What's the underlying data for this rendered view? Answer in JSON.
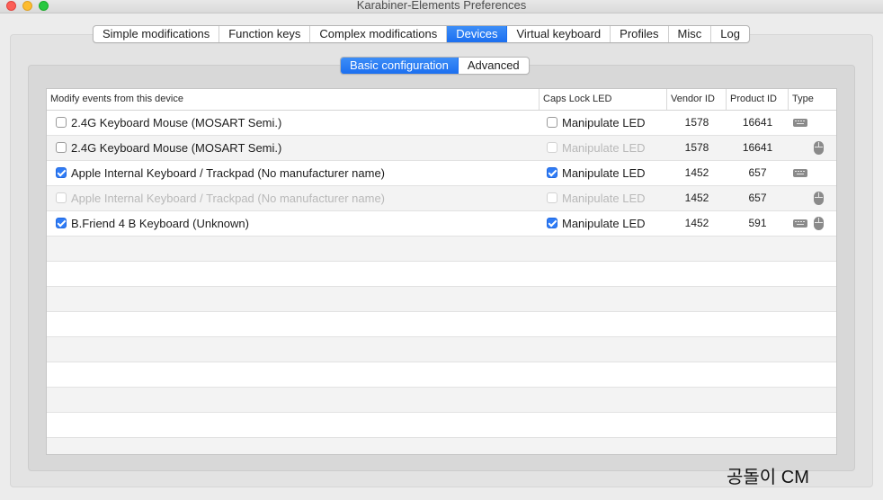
{
  "window": {
    "title": "Karabiner-Elements Preferences"
  },
  "main_tabs": [
    {
      "label": "Simple modifications",
      "active": false
    },
    {
      "label": "Function keys",
      "active": false
    },
    {
      "label": "Complex modifications",
      "active": false
    },
    {
      "label": "Devices",
      "active": true
    },
    {
      "label": "Virtual keyboard",
      "active": false
    },
    {
      "label": "Profiles",
      "active": false
    },
    {
      "label": "Misc",
      "active": false
    },
    {
      "label": "Log",
      "active": false
    }
  ],
  "sub_tabs": [
    {
      "label": "Basic configuration",
      "active": true
    },
    {
      "label": "Advanced",
      "active": false
    }
  ],
  "table": {
    "headers": {
      "modify": "Modify events from this device",
      "caps": "Caps Lock LED",
      "vendor": "Vendor ID",
      "product": "Product ID",
      "type": "Type"
    },
    "rows": [
      {
        "name": "2.4G Keyboard Mouse (MOSART Semi.)",
        "modify_checked": false,
        "modify_enabled": true,
        "led_label": "Manipulate LED",
        "led_checked": false,
        "led_enabled": true,
        "vendor_id": "1578",
        "product_id": "16641",
        "types": [
          "keyboard-icon"
        ]
      },
      {
        "name": "2.4G Keyboard Mouse (MOSART Semi.)",
        "modify_checked": false,
        "modify_enabled": true,
        "led_label": "Manipulate LED",
        "led_checked": false,
        "led_enabled": false,
        "vendor_id": "1578",
        "product_id": "16641",
        "types": [
          "mouse-icon"
        ]
      },
      {
        "name": "Apple Internal Keyboard / Trackpad (No manufacturer name)",
        "modify_checked": true,
        "modify_enabled": true,
        "led_label": "Manipulate LED",
        "led_checked": true,
        "led_enabled": true,
        "vendor_id": "1452",
        "product_id": "657",
        "types": [
          "keyboard-icon"
        ]
      },
      {
        "name": "Apple Internal Keyboard / Trackpad (No manufacturer name)",
        "modify_checked": false,
        "modify_enabled": false,
        "led_label": "Manipulate LED",
        "led_checked": false,
        "led_enabled": false,
        "vendor_id": "1452",
        "product_id": "657",
        "types": [
          "mouse-icon"
        ]
      },
      {
        "name": "B.Friend 4 B Keyboard (Unknown)",
        "modify_checked": true,
        "modify_enabled": true,
        "led_label": "Manipulate LED",
        "led_checked": true,
        "led_enabled": true,
        "vendor_id": "1452",
        "product_id": "591",
        "types": [
          "keyboard-icon",
          "mouse-icon"
        ]
      }
    ],
    "empty_rows": 9
  },
  "watermark": "공돌이 CM"
}
